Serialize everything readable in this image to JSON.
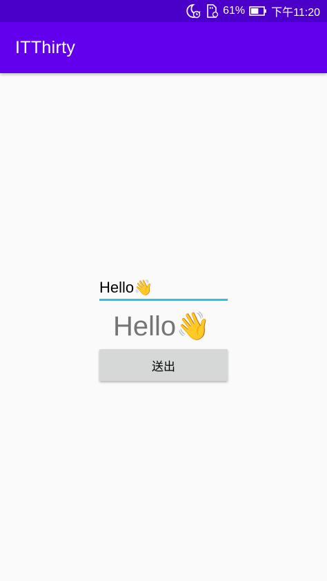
{
  "status_bar": {
    "battery_percent": "61%",
    "time": "下午11:20",
    "icons": [
      "moon-clock-icon",
      "sd-card-icon",
      "battery-icon"
    ],
    "battery_level": 0.61
  },
  "app_bar": {
    "title": "ITThirty",
    "color": "#6200ee",
    "status_color": "#4a00c9"
  },
  "main": {
    "input_value": "Hello👋",
    "display_text": "Hello👋",
    "submit_label": "送出",
    "accent_color": "#26c6da"
  }
}
